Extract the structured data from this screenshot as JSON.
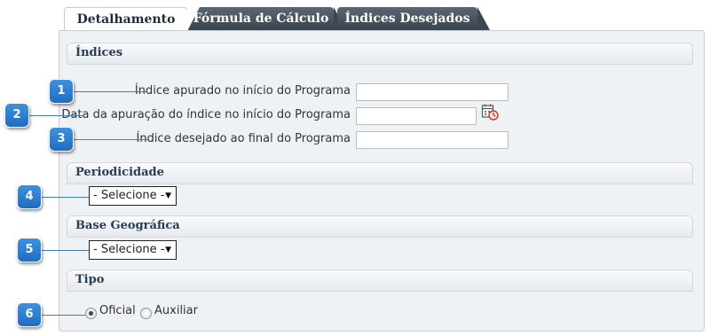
{
  "tabs": {
    "detalhamento": "Detalhamento",
    "formula": "Fórmula de Cálculo",
    "indices_desejados": "Índices Desejados"
  },
  "sections": {
    "indices": {
      "title": "Índices",
      "fields": {
        "indice_apurado": {
          "label": "Índice apurado no início do Programa",
          "value": ""
        },
        "data_apuracao": {
          "label": "Data da apuração do índice no início do Programa",
          "value": ""
        },
        "indice_desejado": {
          "label": "Índice desejado ao final do Programa",
          "value": ""
        }
      }
    },
    "periodicidade": {
      "title": "Periodicidade",
      "select_value": "- Selecione -"
    },
    "base_geografica": {
      "title": "Base Geográfica",
      "select_value": "- Selecione -"
    },
    "tipo": {
      "title": "Tipo",
      "options": {
        "oficial": "Oficial",
        "auxiliar": "Auxiliar"
      },
      "selected": "Oficial"
    }
  },
  "callouts": {
    "c1": "1",
    "c2": "2",
    "c3": "3",
    "c4": "4",
    "c5": "5",
    "c6": "6"
  },
  "icons": {
    "calendar": "calendar-clock-icon",
    "select_arrow": "triangle-down"
  },
  "colors": {
    "badge_blue": "#2a7ad1",
    "tab_dark": "#46515c",
    "section_title": "#2a3c54",
    "panel_bg": "#eef2f5"
  }
}
